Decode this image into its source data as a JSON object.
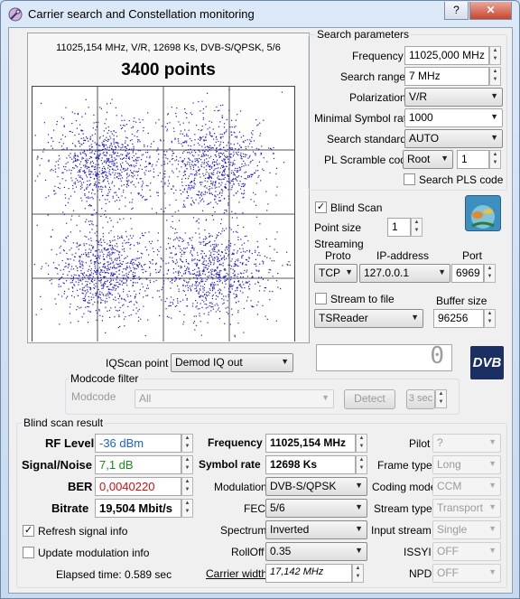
{
  "window": {
    "title": "Carrier search and Constellation monitoring",
    "minimize": "_",
    "maximize": "▭",
    "close": "✕",
    "help": "?"
  },
  "constellation": {
    "header": "11025,154 MHz, V/R, 12698 Ks, DVB-S/QPSK, 5/6",
    "points_label": "3400 points",
    "point_count": 3400,
    "dot_color": "#1b1bd6"
  },
  "search": {
    "title": "Search parameters",
    "frequency_label": "Frequency",
    "frequency_value": "11025,000 MHz",
    "range_label": "Search range",
    "range_value": "7 MHz",
    "polarization_label": "Polarization",
    "polarization_value": "V/R",
    "min_sr_label": "Minimal Symbol rate",
    "min_sr_value": "1000",
    "standard_label": "Search standard",
    "standard_value": "AUTO",
    "pls_label": "PL Scramble code",
    "pls_mode": "Root",
    "pls_value": "1",
    "search_pls_label": "Search PLS code"
  },
  "blind_scan": {
    "label": "Blind Scan",
    "checked": true
  },
  "point_size": {
    "label": "Point size",
    "value": "1"
  },
  "streaming": {
    "title": "Streaming",
    "proto_label": "Proto",
    "proto_value": "TCP",
    "ip_label": "IP-address",
    "ip_value": "127.0.0.1",
    "port_label": "Port",
    "port_value": "6969",
    "stream_to_file_label": "Stream to file",
    "buffer_label": "Buffer size",
    "buffer_value": "96256",
    "reader_value": "TSReader"
  },
  "iq": {
    "label": "IQScan point",
    "value": "Demod IQ out",
    "counter": "0"
  },
  "modcode": {
    "title": "Modcode filter",
    "label": "Modcode",
    "value": "All",
    "detect": "Detect",
    "interval": "3 sec"
  },
  "result": {
    "title": "Blind scan result",
    "rf_level_label": "RF Level",
    "rf_level_value": "-36 dBm",
    "rf_color": "#1f5fd0",
    "snr_label": "Signal/Noise",
    "snr_value": "7,1 dB",
    "snr_color": "#1a8a1a",
    "ber_label": "BER",
    "ber_value": "0,0040220",
    "ber_color": "#d01010",
    "bitrate_label": "Bitrate",
    "bitrate_value": "19,504 Mbit/s",
    "refresh_label": "Refresh signal info",
    "refresh_checked": true,
    "update_mod_label": "Update modulation info",
    "update_mod_checked": false,
    "elapsed": "Elapsed time: 0.589 sec",
    "frequency_label": "Frequency",
    "frequency_value": "11025,154 MHz",
    "sr_label": "Symbol rate",
    "sr_value": "12698 Ks",
    "modulation_label": "Modulation",
    "modulation_value": "DVB-S/QPSK",
    "fec_label": "FEC",
    "fec_value": "5/6",
    "spectrum_label": "Spectrum",
    "spectrum_value": "Inverted",
    "rolloff_label": "RollOff",
    "rolloff_value": "0.35",
    "carrier_width_label": "Carrier width",
    "carrier_width_value": "17,142 MHz",
    "pilot_label": "Pilot",
    "pilot_value": "?",
    "frame_label": "Frame type",
    "frame_value": "Long",
    "coding_label": "Coding mode",
    "coding_value": "CCM",
    "stream_type_label": "Stream type",
    "stream_type_value": "Transport",
    "input_stream_label": "Input stream",
    "input_stream_value": "Single",
    "issyi_label": "ISSYI",
    "issyi_value": "OFF",
    "npd_label": "NPD",
    "npd_value": "OFF"
  },
  "dvb_logo": "DVB"
}
